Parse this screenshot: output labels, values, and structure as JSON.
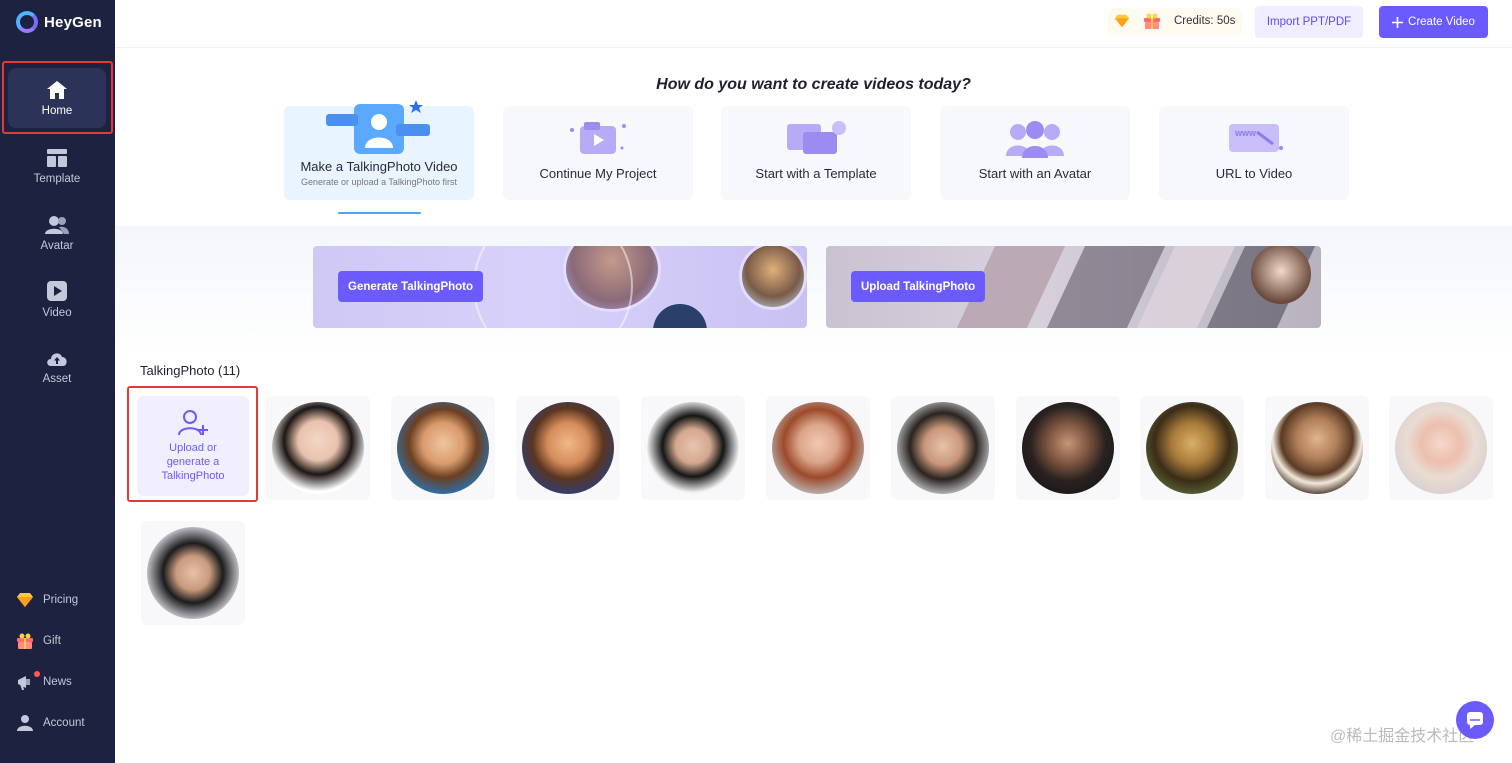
{
  "app": {
    "name": "HeyGen"
  },
  "sidebar": {
    "items": [
      {
        "label": "Home",
        "icon": "home-icon"
      },
      {
        "label": "Template",
        "icon": "template-icon"
      },
      {
        "label": "Avatar",
        "icon": "avatar-icon"
      },
      {
        "label": "Video",
        "icon": "video-icon"
      },
      {
        "label": "Asset",
        "icon": "cloud-upload-icon"
      }
    ],
    "bottom_items": [
      {
        "label": "Pricing",
        "icon": "diamond-icon"
      },
      {
        "label": "Gift",
        "icon": "gift-icon"
      },
      {
        "label": "News",
        "icon": "megaphone-icon"
      },
      {
        "label": "Account",
        "icon": "person-icon"
      }
    ]
  },
  "header": {
    "credits": "Credits: 50s",
    "import_label": "Import PPT/PDF",
    "create_label": "Create Video",
    "create_icon": "plus-icon"
  },
  "main": {
    "headline": "How do you want to create videos today?",
    "options": [
      {
        "title": "Make a TalkingPhoto Video",
        "subtitle": "Generate or upload a TalkingPhoto first",
        "active": true
      },
      {
        "title": "Continue My Project"
      },
      {
        "title": "Start with a Template"
      },
      {
        "title": "Start with an Avatar"
      },
      {
        "title": "URL to Video"
      }
    ],
    "banners": {
      "generate_label": "Generate TalkingPhoto",
      "upload_label": "Upload TalkingPhoto"
    },
    "talking_photos": {
      "title": "TalkingPhoto (11)",
      "upload_card_text": "Upload or generate a TalkingPhoto",
      "photos": [
        "woman-portrait",
        "cartoon-boy",
        "cartoon-man",
        "young-man-portrait",
        "redhead-woman",
        "curly-hair-boy",
        "man-with-glasses",
        "mona-lisa",
        "shakespeare",
        "blonde-woman",
        "dark-hair-man"
      ]
    }
  },
  "colors": {
    "sidebar_bg": "#1c2240",
    "accent": "#6b5bff",
    "highlight": "#e53935"
  },
  "watermark": "@稀土掘金技术社区"
}
